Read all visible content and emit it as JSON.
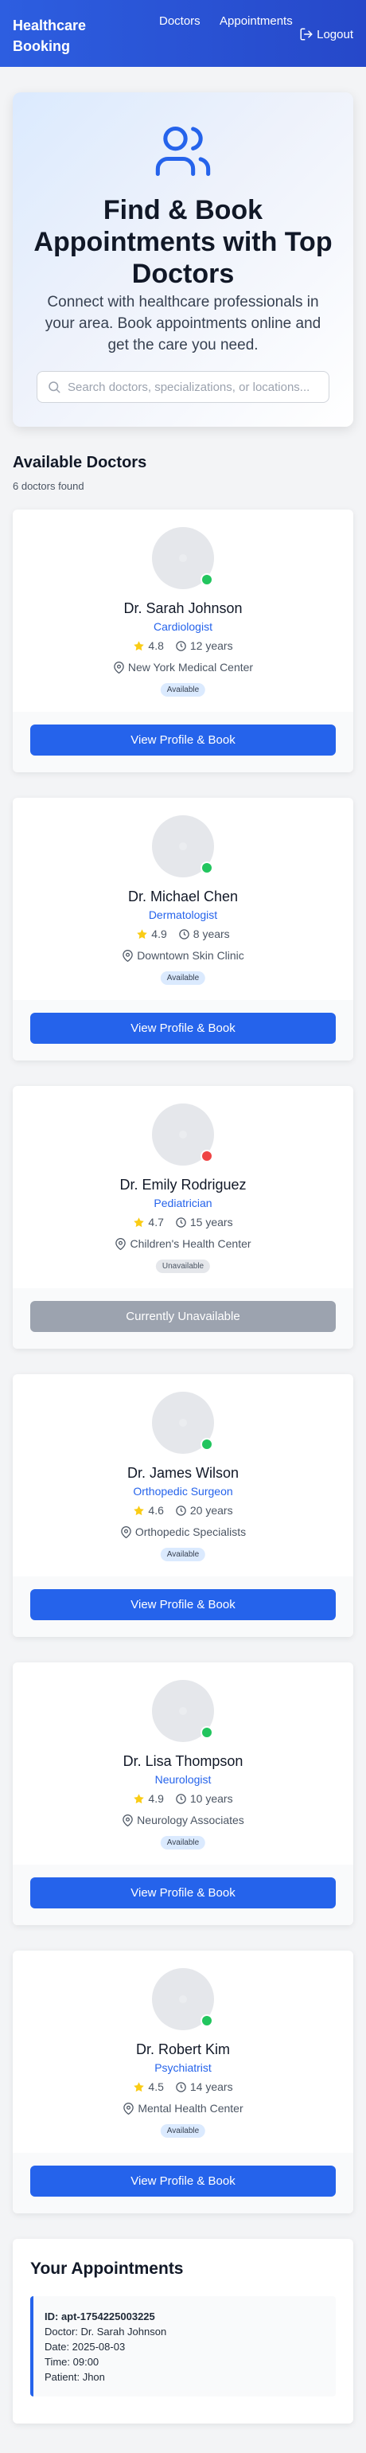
{
  "header": {
    "brand": "Healthcare Booking",
    "nav": [
      "Doctors",
      "Appointments"
    ],
    "logout": "Logout"
  },
  "hero": {
    "icon": "users-icon",
    "title": "Find & Book Appointments with Top Doctors",
    "subtitle": "Connect with healthcare professionals in your area. Book appointments online and get the care you need.",
    "search_placeholder": "Search doctors, specializations, or locations..."
  },
  "doctors_section": {
    "title": "Available Doctors",
    "count": "6 doctors found"
  },
  "colors": {
    "primary": "#2563eb",
    "available_dot": "#22c55e",
    "unavailable_dot": "#ef4444",
    "star": "#facc15"
  },
  "doctors": [
    {
      "name": "Dr. Sarah Johnson",
      "specialization": "Cardiologist",
      "rating": "4.8",
      "experience": "12 years",
      "location": "New York Medical Center",
      "status": "Available",
      "available": true,
      "action": "View Profile & Book"
    },
    {
      "name": "Dr. Michael Chen",
      "specialization": "Dermatologist",
      "rating": "4.9",
      "experience": "8 years",
      "location": "Downtown Skin Clinic",
      "status": "Available",
      "available": true,
      "action": "View Profile & Book"
    },
    {
      "name": "Dr. Emily Rodriguez",
      "specialization": "Pediatrician",
      "rating": "4.7",
      "experience": "15 years",
      "location": "Children's Health Center",
      "status": "Unavailable",
      "available": false,
      "action": "Currently Unavailable"
    },
    {
      "name": "Dr. James Wilson",
      "specialization": "Orthopedic Surgeon",
      "rating": "4.6",
      "experience": "20 years",
      "location": "Orthopedic Specialists",
      "status": "Available",
      "available": true,
      "action": "View Profile & Book"
    },
    {
      "name": "Dr. Lisa Thompson",
      "specialization": "Neurologist",
      "rating": "4.9",
      "experience": "10 years",
      "location": "Neurology Associates",
      "status": "Available",
      "available": true,
      "action": "View Profile & Book"
    },
    {
      "name": "Dr. Robert Kim",
      "specialization": "Psychiatrist",
      "rating": "4.5",
      "experience": "14 years",
      "location": "Mental Health Center",
      "status": "Available",
      "available": true,
      "action": "View Profile & Book"
    }
  ],
  "appointments": {
    "title": "Your Appointments",
    "items": [
      {
        "id": "ID: apt-1754225003225",
        "doctor": "Doctor: Dr. Sarah Johnson",
        "date": "Date: 2025-08-03",
        "time": "Time: 09:00",
        "patient": "Patient: Jhon"
      }
    ]
  }
}
